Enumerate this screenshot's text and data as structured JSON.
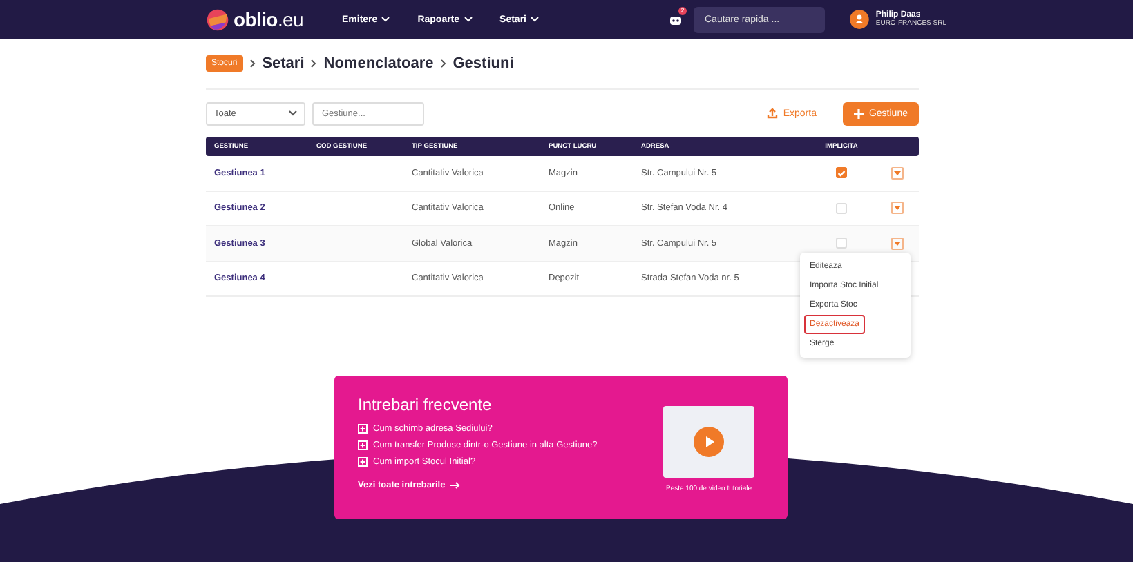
{
  "nav": {
    "logo": "**oblio**.eu",
    "menu": [
      {
        "label": "Emitere"
      },
      {
        "label": "Rapoarte"
      },
      {
        "label": "Setari"
      }
    ],
    "notification_count": "2",
    "search": {
      "placeholder": "Cautare rapida ..."
    },
    "user": {
      "name": "Philip Daas",
      "company": "EURO-FRANCES SRL"
    }
  },
  "breadcrumb": {
    "badge": "Stocuri",
    "items": [
      "Setari",
      "Nomenclatoare",
      "Gestiuni"
    ]
  },
  "filters": {
    "select": "Toate",
    "search": {
      "placeholder": "Gestiune..."
    }
  },
  "actions": {
    "export": "Exporta",
    "add": "Gestiune"
  },
  "table": {
    "columns": [
      "GESTIUNE",
      "COD GESTIUNE",
      "TIP GESTIUNE",
      "PUNCT LUCRU",
      "ADRESA",
      "IMPLICITA"
    ],
    "rows": [
      {
        "name": "Gestiunea 1",
        "type": "Cantitativ Valorica",
        "point": "Magzin",
        "address": "Str. Campului Nr. 5",
        "default": true,
        "menu_open": false
      },
      {
        "name": "Gestiunea 2",
        "type": "Cantitativ Valorica",
        "point": "Online",
        "address": "Str. Stefan Voda Nr. 4",
        "default": false,
        "menu_open": false
      },
      {
        "name": "Gestiunea 3",
        "type": "Global Valorica",
        "point": "Magzin",
        "address": "Str. Campului Nr. 5",
        "default": false,
        "menu_open": true
      },
      {
        "name": "Gestiunea 4",
        "type": "Cantitativ Valorica",
        "point": "Depozit",
        "address": "Strada Stefan Voda nr. 5",
        "default": null,
        "menu_open": false
      }
    ]
  },
  "row_menu": {
    "items": [
      {
        "label": "Editeaza",
        "highlighted": false
      },
      {
        "label": "Importa Stoc Initial",
        "highlighted": false
      },
      {
        "label": "Exporta Stoc",
        "highlighted": false
      },
      {
        "label": "Dezactiveaza",
        "highlighted": true
      },
      {
        "label": "Sterge",
        "highlighted": false
      }
    ]
  },
  "faq": {
    "title": "Intrebari frecvente",
    "questions": [
      "Cum schimb adresa Sediului?",
      "Cum transfer Produse dintr-o Gestiune in alta Gestiune?",
      "Cum import Stocul Initial?"
    ],
    "more": "Vezi toate intrebarile",
    "video_caption": "Peste 100 de video tutoriale"
  }
}
